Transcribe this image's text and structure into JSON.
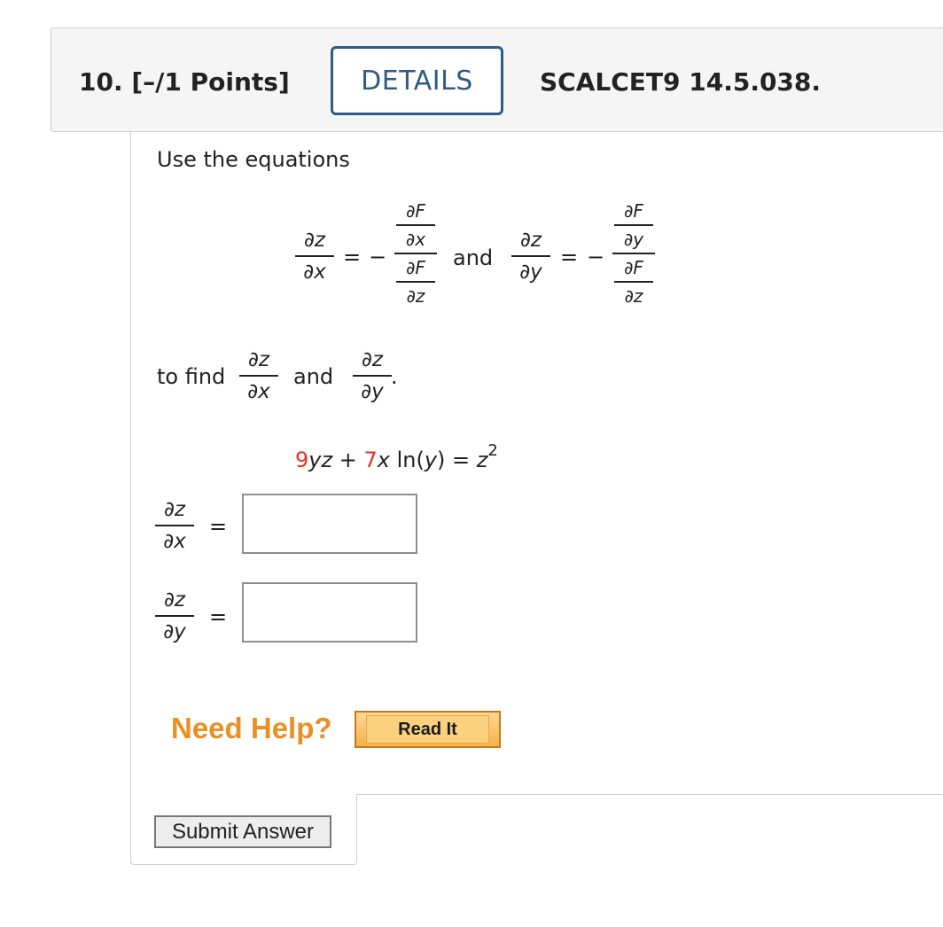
{
  "header": {
    "question_number": "10.",
    "points": "[–/1 Points]",
    "details_label": "DETAILS",
    "problem_code": "SCALCET9 14.5.038."
  },
  "problem": {
    "intro": "Use the equations",
    "and_word": "and",
    "minus": "−",
    "equals": "=",
    "dz": "∂z",
    "dx": "∂x",
    "dy": "∂y",
    "dF": "∂F",
    "to_find": "to find",
    "period": ".",
    "equation": {
      "c1": "9",
      "t1": "yz",
      "plus": " + ",
      "c2": "7",
      "t2": "x",
      "t3": " ln(",
      "t4": "y",
      "t5": ") = ",
      "t6": "z",
      "exp": "2"
    }
  },
  "answers": {
    "dz_dx_value": "",
    "dz_dy_value": ""
  },
  "help": {
    "need_help_label": "Need Help?",
    "read_it_label": "Read It"
  },
  "submit_label": "Submit Answer",
  "colors": {
    "details_border": "#2f5b86",
    "coefficient_red": "#e8311f",
    "need_help_orange": "#e89024"
  }
}
